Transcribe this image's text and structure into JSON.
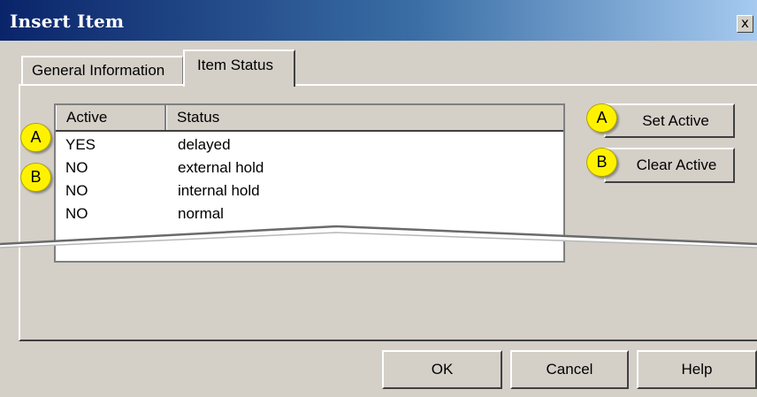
{
  "window": {
    "title": "Insert Item",
    "close_glyph": "x"
  },
  "tabs": [
    {
      "label": "General Information",
      "active": false
    },
    {
      "label": "Item Status",
      "active": true
    }
  ],
  "list": {
    "columns": [
      "Active",
      "Status"
    ],
    "rows": [
      {
        "active": "YES",
        "status": "delayed"
      },
      {
        "active": "NO",
        "status": "external hold"
      },
      {
        "active": "NO",
        "status": "internal hold"
      },
      {
        "active": "NO",
        "status": "normal"
      }
    ]
  },
  "buttons": {
    "set_active": "Set Active",
    "clear_active": "Clear Active",
    "ok": "OK",
    "cancel": "Cancel",
    "help": "Help"
  },
  "callouts": {
    "a": "A",
    "b": "B"
  },
  "colors": {
    "title_bar": "#0a246a",
    "dialog_face": "#d4d0c8",
    "callout": "#fff200"
  }
}
